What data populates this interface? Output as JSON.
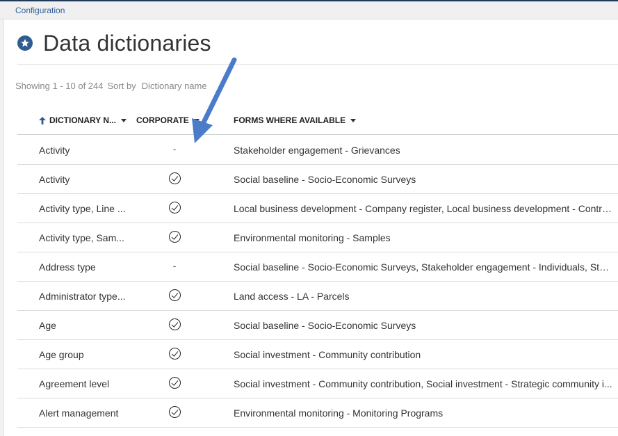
{
  "breadcrumb": "Configuration",
  "page": {
    "title": "Data dictionaries",
    "title_icon": "star-circle-icon",
    "accent_color": "#2f5d92"
  },
  "listing": {
    "showing": "Showing 1 - 10 of 244",
    "sort_label": "Sort by",
    "sort_value": "Dictionary name"
  },
  "columns": {
    "name": "DICTIONARY N...",
    "corporate": "CORPORATE",
    "forms": "FORMS WHERE AVAILABLE"
  },
  "rows": [
    {
      "name": "Activity",
      "corporate": "-",
      "forms": "Stakeholder engagement - Grievances"
    },
    {
      "name": "Activity",
      "corporate": "check",
      "forms": "Social baseline - Socio-Economic Surveys"
    },
    {
      "name": "Activity type, Line ...",
      "corporate": "check",
      "forms": "Local business development - Company register, Local business development - Contra..."
    },
    {
      "name": "Activity type, Sam...",
      "corporate": "check",
      "forms": "Environmental monitoring - Samples"
    },
    {
      "name": "Address type",
      "corporate": "-",
      "forms": "Social baseline - Socio-Economic Surveys, Stakeholder engagement - Individuals, Stak..."
    },
    {
      "name": "Administrator type...",
      "corporate": "check",
      "forms": "Land access - LA - Parcels"
    },
    {
      "name": "Age",
      "corporate": "check",
      "forms": "Social baseline - Socio-Economic Surveys"
    },
    {
      "name": "Age group",
      "corporate": "check",
      "forms": "Social investment - Community contribution"
    },
    {
      "name": "Agreement level",
      "corporate": "check",
      "forms": "Social investment - Community contribution, Social investment - Strategic community i..."
    },
    {
      "name": "Alert management",
      "corporate": "check",
      "forms": "Environmental monitoring - Monitoring Programs"
    }
  ],
  "annotation_arrow_color": "#4a7cc9"
}
